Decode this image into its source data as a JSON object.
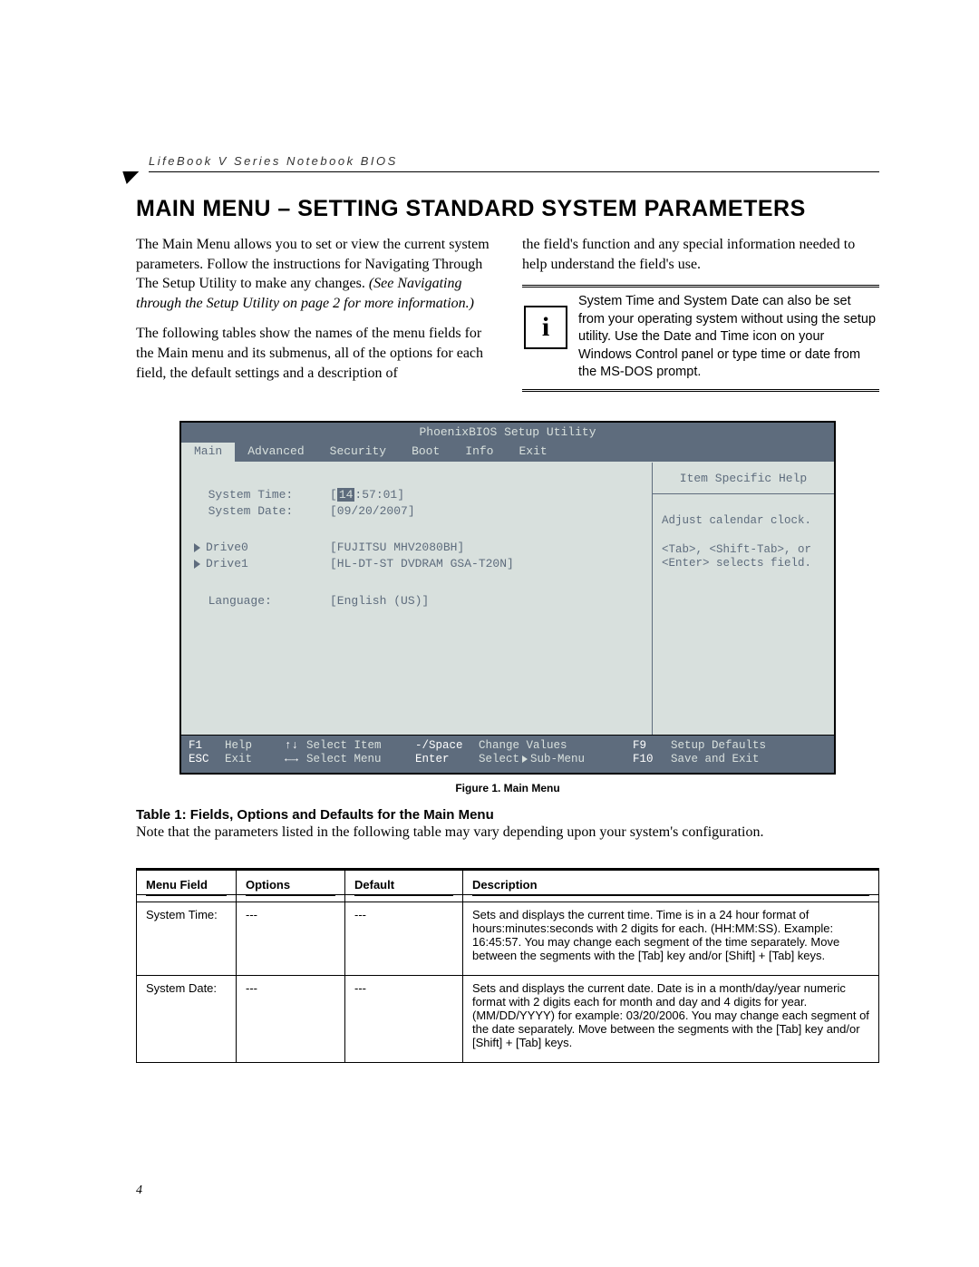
{
  "running_head": "LifeBook V Series Notebook BIOS",
  "page_title": "MAIN MENU – SETTING STANDARD SYSTEM PARAMETERS",
  "left_col": {
    "p1": "The Main Menu allows you to set or view the current system parameters. Follow the instructions for Navigating Through The Setup Utility to make any changes.",
    "p1i": "(See Navigating through the Setup Utility on page 2 for more information.)",
    "p2": "The following tables show the names of the menu fields for the Main menu and its submenus, all of the options for each field, the default settings and a description of"
  },
  "right_col": {
    "p1": "the field's function and any special information needed to help understand the field's use.",
    "info": "System Time and System Date can also be set from your operating system without using the setup utility. Use the Date and Time icon on your Windows Control panel or type time or date from the MS-DOS prompt."
  },
  "bios": {
    "title": "PhoenixBIOS Setup Utility",
    "tabs": [
      "Main",
      "Advanced",
      "Security",
      "Boot",
      "Info",
      "Exit"
    ],
    "system_time_label": "System Time:",
    "system_time_hl": "14",
    "system_time_rest": ":57:01]",
    "system_date_label": "System Date:",
    "system_date_val": "[09/20/2007]",
    "drive0_label": "Drive0",
    "drive0_val": "[FUJITSU MHV2080BH]",
    "drive1_label": "Drive1",
    "drive1_val": "[HL-DT-ST DVDRAM GSA-T20N]",
    "language_label": "Language:",
    "language_val": "[English (US)]",
    "help_title": "Item Specific Help",
    "help_l1": "Adjust calendar clock.",
    "help_l2": "<Tab>, <Shift-Tab>, or",
    "help_l3": "<Enter> selects field.",
    "footer": {
      "f1": "F1",
      "help": "Help",
      "arrows_ud": "↑↓",
      "select_item": "Select Item",
      "minus_space": "-/Space",
      "change_values": "Change Values",
      "f9": "F9",
      "setup_defaults": "Setup Defaults",
      "esc": "ESC",
      "exit": "Exit",
      "arrows_lr": "←→",
      "select_menu": "Select Menu",
      "enter": "Enter",
      "select_submenu": "Select ▶ Sub-Menu",
      "f10": "F10",
      "save_exit": "Save and Exit"
    }
  },
  "figure_caption": "Figure 1.  Main Menu",
  "table_title": "Table 1: Fields, Options and Defaults for the Main Menu",
  "table_note": "Note that the parameters listed in the following table may vary depending upon your system's configuration.",
  "table": {
    "headers": [
      "Menu Field",
      "Options",
      "Default",
      "Description"
    ],
    "rows": [
      {
        "field": "System Time:",
        "options": "---",
        "default": "---",
        "desc": "Sets and displays the current time. Time is in a 24 hour format of hours:minutes:seconds with 2 digits for each. (HH:MM:SS). Example: 16:45:57. You may change each segment of the time separately. Move between the segments with the [Tab] key and/or [Shift] + [Tab] keys."
      },
      {
        "field": "System Date:",
        "options": "---",
        "default": "---",
        "desc": "Sets and displays the current date. Date is in a month/day/year numeric format with 2 digits each for month and day and 4 digits for year. (MM/DD/YYYY) for example: 03/20/2006. You may change each segment of the date separately. Move between the segments with the [Tab] key and/or [Shift] + [Tab] keys."
      }
    ]
  },
  "page_number": "4"
}
